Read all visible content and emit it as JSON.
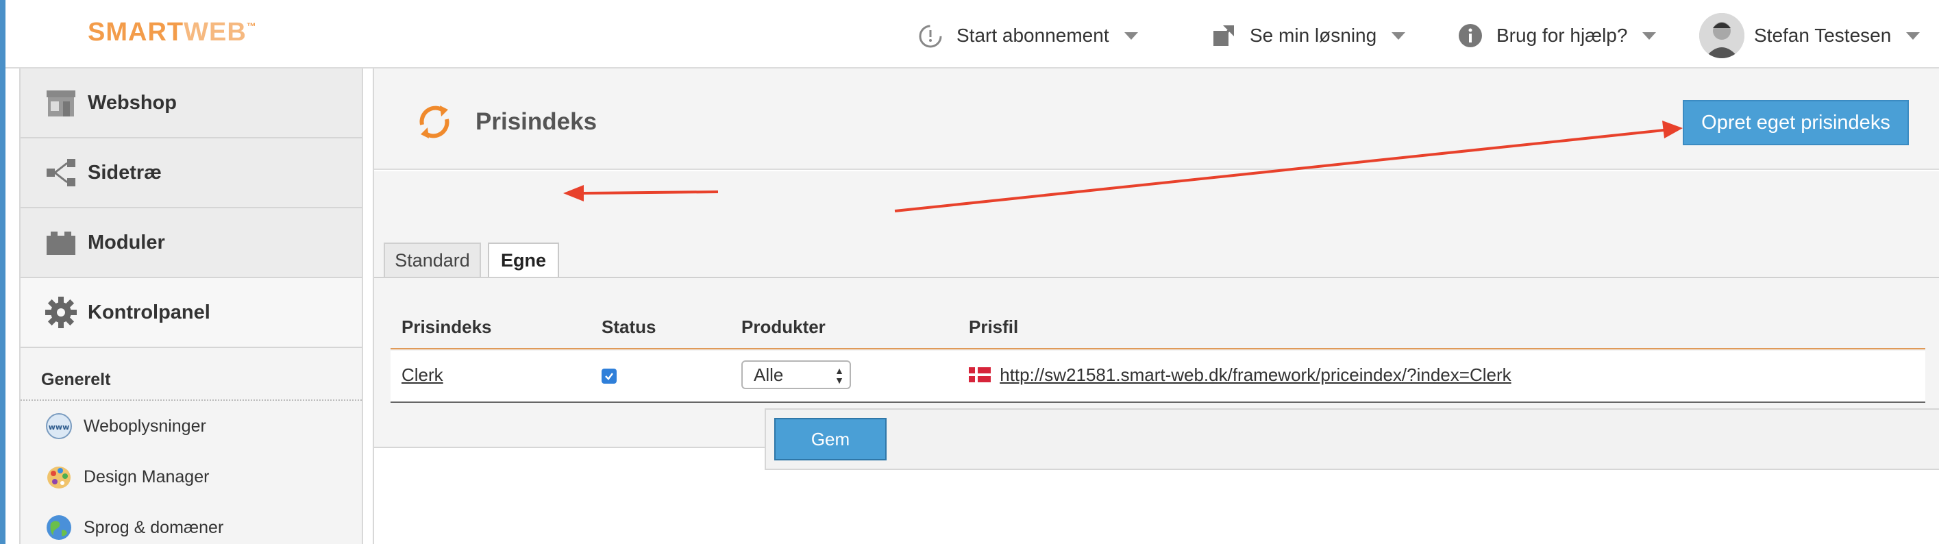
{
  "logo": {
    "part1": "SMART",
    "part2": "WEB",
    "tm": "™"
  },
  "topnav": {
    "subscription": "Start abonnement",
    "view_solution": "Se min løsning",
    "help": "Brug for hjælp?",
    "user_name": "Stefan Testesen"
  },
  "sidebar": {
    "main_items": [
      {
        "label": "Webshop",
        "icon": "store-icon"
      },
      {
        "label": "Sidetræ",
        "icon": "sitetree-icon"
      },
      {
        "label": "Moduler",
        "icon": "modules-icon"
      },
      {
        "label": "Kontrolpanel",
        "icon": "gear-icon"
      }
    ],
    "section_title": "Generelt",
    "sub_items": [
      {
        "label": "Weboplysninger",
        "icon": "www-icon"
      },
      {
        "label": "Design Manager",
        "icon": "palette-icon"
      },
      {
        "label": "Sprog & domæner",
        "icon": "globe-icon"
      }
    ]
  },
  "page": {
    "title": "Prisindeks",
    "create_button": "Opret eget prisindeks",
    "tabs": [
      "Standard",
      "Egne"
    ],
    "active_tab": "Egne"
  },
  "table": {
    "headers": [
      "Prisindeks",
      "Status",
      "Produkter",
      "Prisfil"
    ],
    "rows": [
      {
        "name": "Clerk",
        "status_checked": true,
        "products": "Alle",
        "price_file": "http://sw21581.smart-web.dk/framework/priceindex/?index=Clerk"
      }
    ]
  },
  "save_label": "Gem",
  "colors": {
    "brand_orange": "#f39c4a",
    "primary_blue": "#4a9fd6",
    "annotation_red": "#e8412b"
  }
}
